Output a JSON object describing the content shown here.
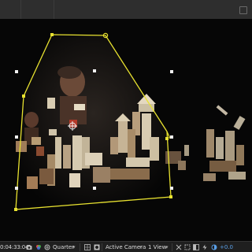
{
  "viewer": {
    "mask_color": "#e8e230",
    "background_color": "#070707"
  },
  "status_bar": {
    "timecode": "0:04:33:04",
    "resolution": "Quarter",
    "camera": "Active Camera",
    "views": "1 View",
    "exposure": "+0.0",
    "accent_color": "#5aa0e8",
    "icons": [
      "camera-icon",
      "color-palette-icon",
      "fx-icon",
      "chevron-down-icon",
      "grid-icon",
      "mask-icon",
      "snap-icon",
      "region-of-interest-icon",
      "layout-icon",
      "fast-preview-icon",
      "exposure-icon"
    ]
  }
}
